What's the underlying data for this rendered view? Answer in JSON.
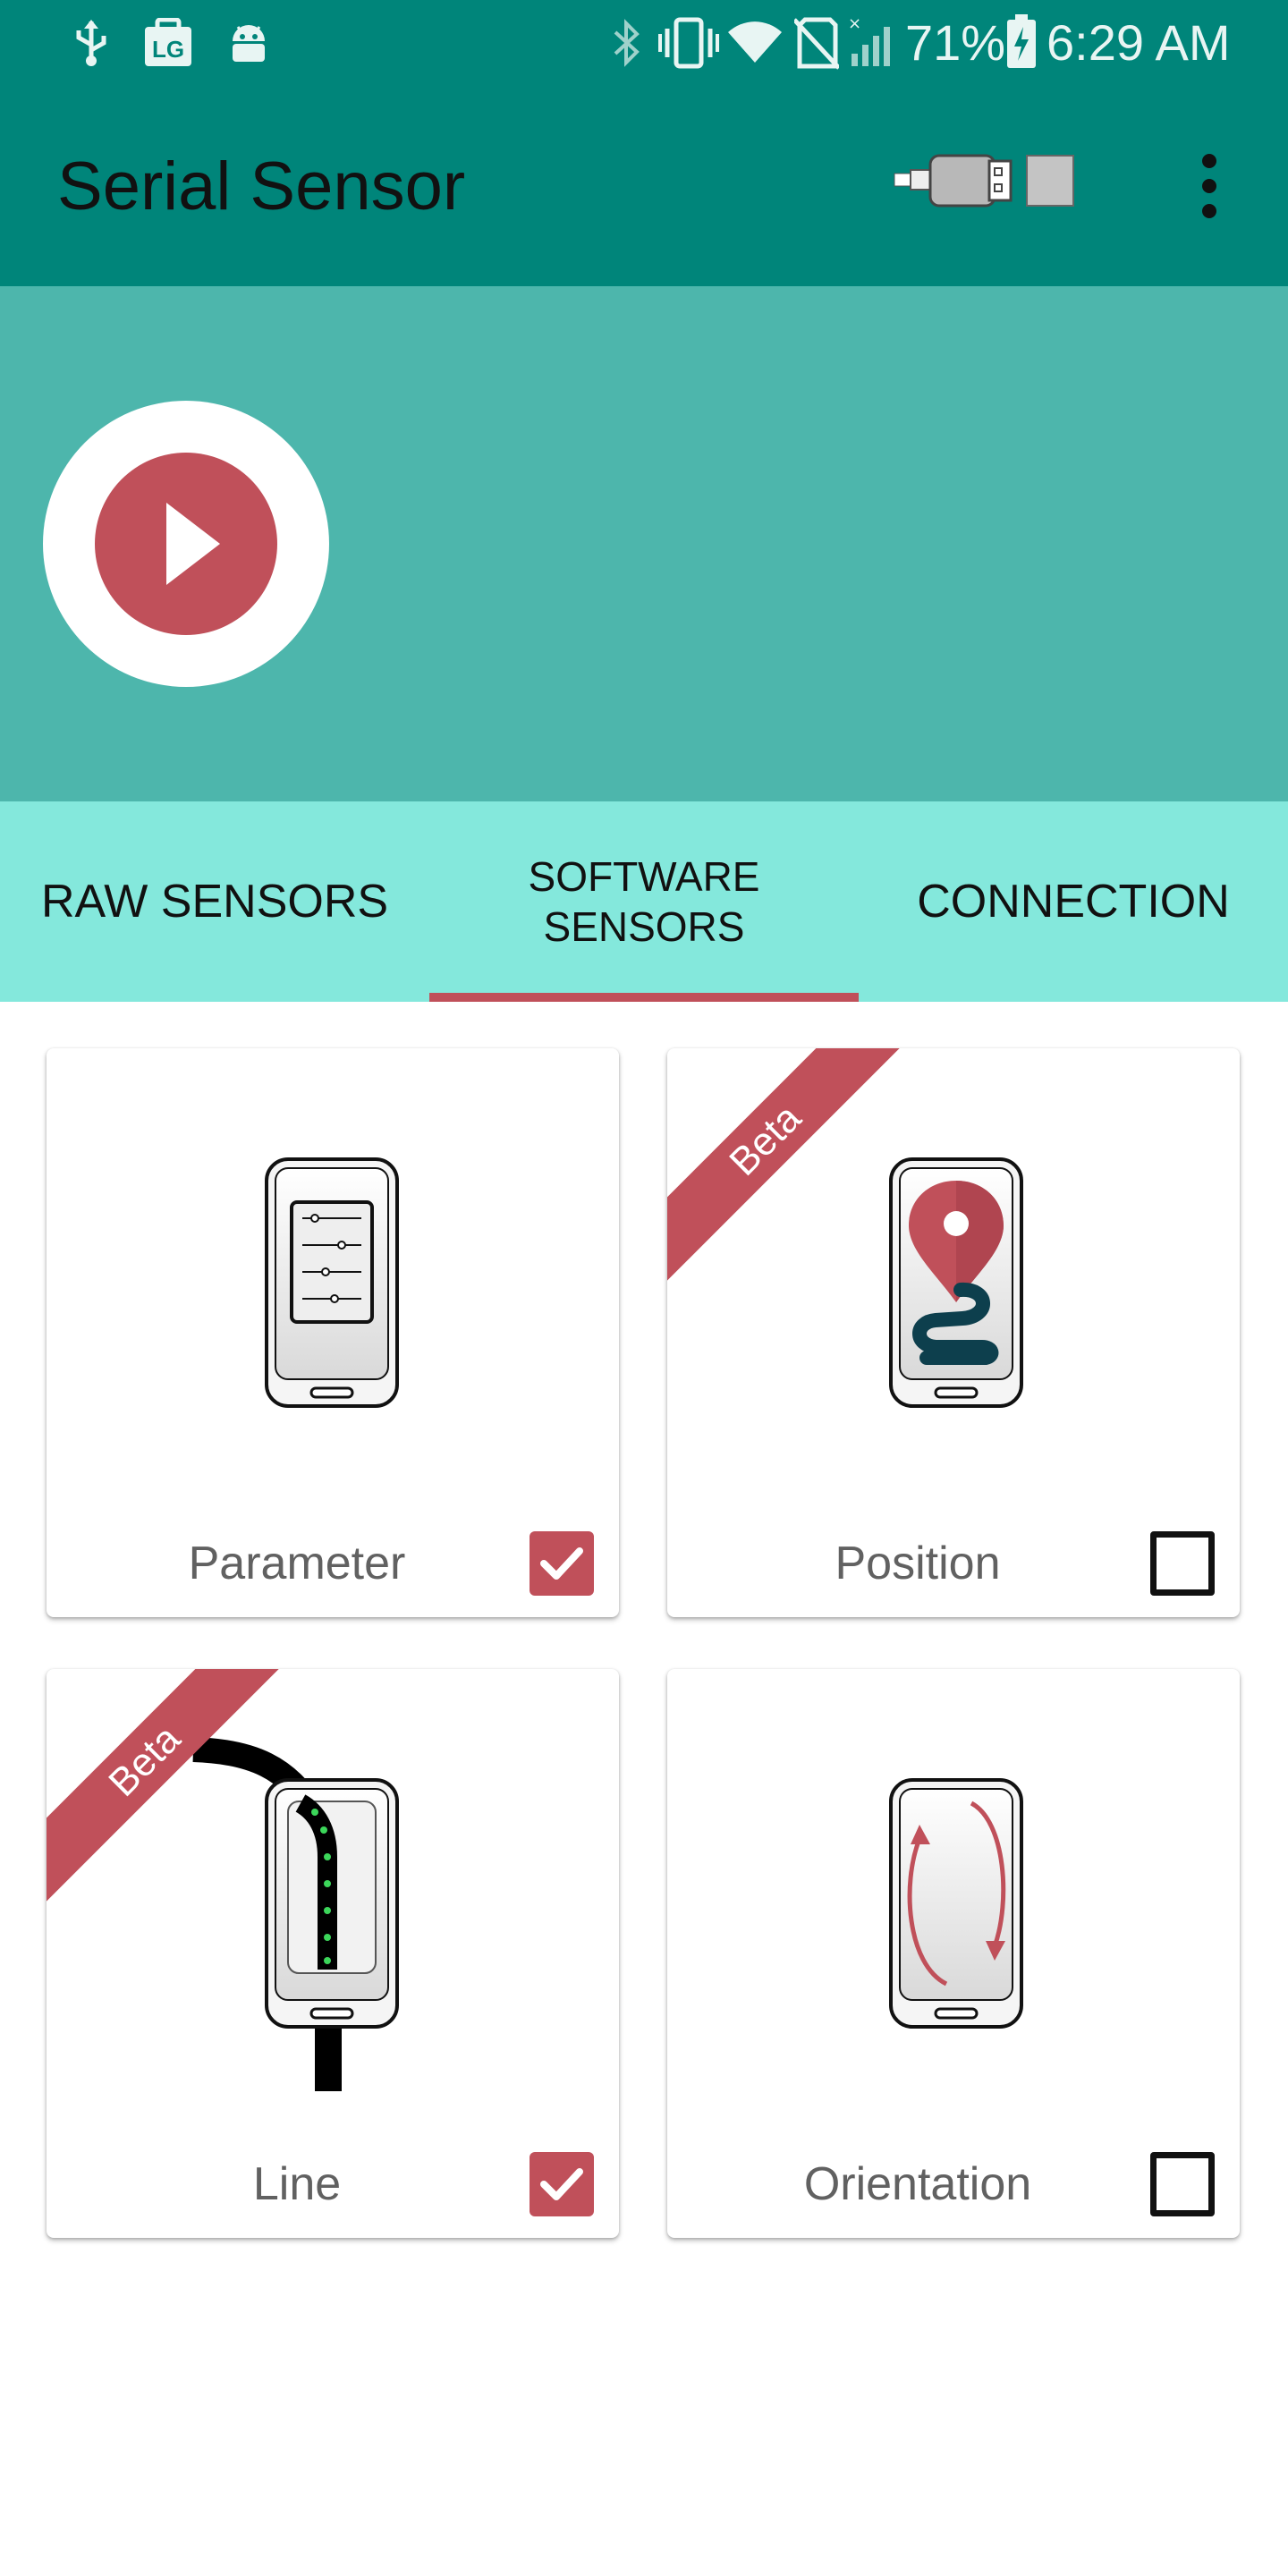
{
  "status_bar": {
    "battery_percent": "71%",
    "time": "6:29 AM",
    "left_icons": [
      "usb-icon",
      "lg-icon",
      "android-debug-icon"
    ],
    "right_icons": [
      "bluetooth-icon",
      "vibrate-icon",
      "wifi-icon",
      "no-sim-icon",
      "signal-icon",
      "battery-charging-icon"
    ]
  },
  "app_bar": {
    "title": "Serial Sensor",
    "actions": [
      "usb-connector-icon",
      "more-vert-icon"
    ]
  },
  "hero": {
    "fab_icon": "play-icon"
  },
  "tabs": {
    "items": [
      {
        "label": "RAW SENSORS"
      },
      {
        "line1": "SOFTWARE",
        "line2": "SENSORS",
        "selected": true
      },
      {
        "label": "CONNECTION"
      }
    ]
  },
  "sensors": [
    {
      "label": "Parameter",
      "checked": true,
      "beta": false,
      "icon": "parameter-phone-icon"
    },
    {
      "label": "Position",
      "checked": false,
      "beta": true,
      "beta_label": "Beta",
      "icon": "position-phone-icon"
    },
    {
      "label": "Line",
      "checked": true,
      "beta": true,
      "beta_label": "Beta",
      "icon": "line-phone-icon"
    },
    {
      "label": "Orientation",
      "checked": false,
      "beta": false,
      "icon": "orientation-phone-icon"
    }
  ],
  "colors": {
    "primary_dark": "#00857a",
    "hero": "#4db6ac",
    "tabs": "#84e8dc",
    "accent": "#c0505a"
  }
}
